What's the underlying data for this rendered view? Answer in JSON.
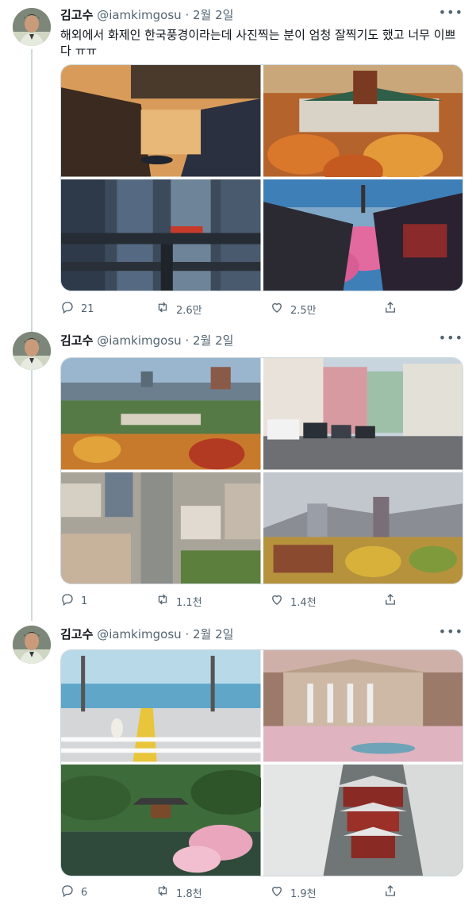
{
  "tweets": [
    {
      "name": "김고수",
      "handle": "@iamkimgosu",
      "separator": "·",
      "date": "2월 2일",
      "text": "해외에서 화제인 한국풍경이라는데 사진찍는 분이 엄청 잘찍기도 했고 너무 이쁘다 ㅠㅠ",
      "replies": "21",
      "retweets": "2.6만",
      "likes": "2.5만"
    },
    {
      "name": "김고수",
      "handle": "@iamkimgosu",
      "separator": "·",
      "date": "2월 2일",
      "text": "",
      "replies": "1",
      "retweets": "1.1천",
      "likes": "1.4천"
    },
    {
      "name": "김고수",
      "handle": "@iamkimgosu",
      "separator": "·",
      "date": "2월 2일",
      "text": "",
      "replies": "6",
      "retweets": "1.8천",
      "likes": "1.9천"
    }
  ],
  "icons": {
    "more": "more-icon",
    "reply": "reply-icon",
    "retweet": "retweet-icon",
    "like": "heart-icon",
    "share": "share-icon"
  },
  "colors": {
    "text_primary": "#0f1419",
    "text_secondary": "#536471",
    "thread_line": "#cfd9de"
  }
}
